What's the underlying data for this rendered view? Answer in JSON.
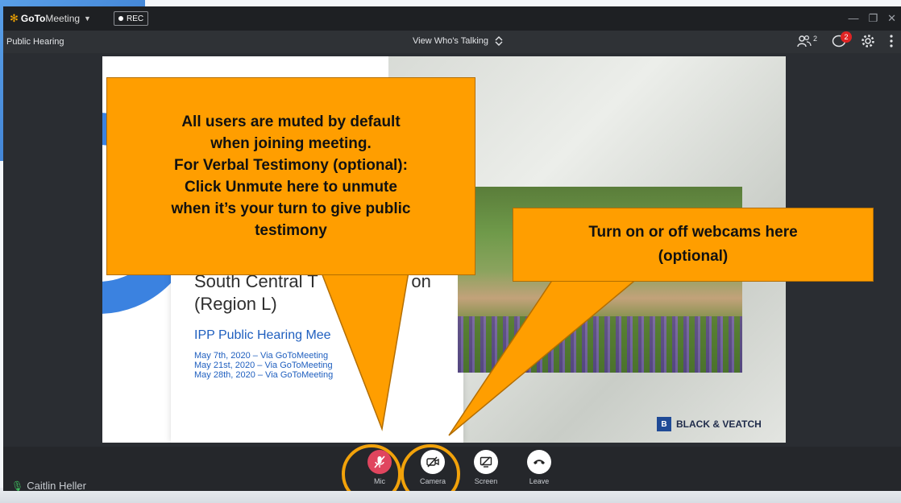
{
  "app": {
    "brand_goto": "GoTo",
    "brand_meeting": "Meeting",
    "rec_label": "REC"
  },
  "subbar": {
    "meeting_title": "Public Hearing",
    "view_mode": "View Who's Talking",
    "attendee_count": "2",
    "chat_badge": "2"
  },
  "slide": {
    "title_line1": "South Central T",
    "title_suffix": "on",
    "title_line2": "(Region L)",
    "subtitle": "IPP Public Hearing Mee",
    "dates": [
      "May 7th, 2020 – Via GoToMeeting",
      "May 21st, 2020 – Via GoToMeeting",
      "May 28th, 2020 – Via GoToMeeting"
    ],
    "logo_text": "BLACK & VEATCH"
  },
  "callouts": {
    "mic": "All users are muted by default\nwhen joining meeting.\nFor Verbal Testimony (optional):\nClick Unmute here to unmute\nwhen it’s your turn to give public\ntestimony",
    "camera": "Turn on or off webcams here\n(optional)"
  },
  "controls": {
    "mic_label": "Mic",
    "camera_label": "Camera",
    "screen_label": "Screen",
    "leave_label": "Leave"
  },
  "speaker": {
    "name": "Caitlin Heller"
  },
  "colors": {
    "callout": "#ff9e00",
    "ring": "#f2a20a",
    "mic_muted": "#e0455e",
    "accent_blue": "#3b82e0"
  }
}
